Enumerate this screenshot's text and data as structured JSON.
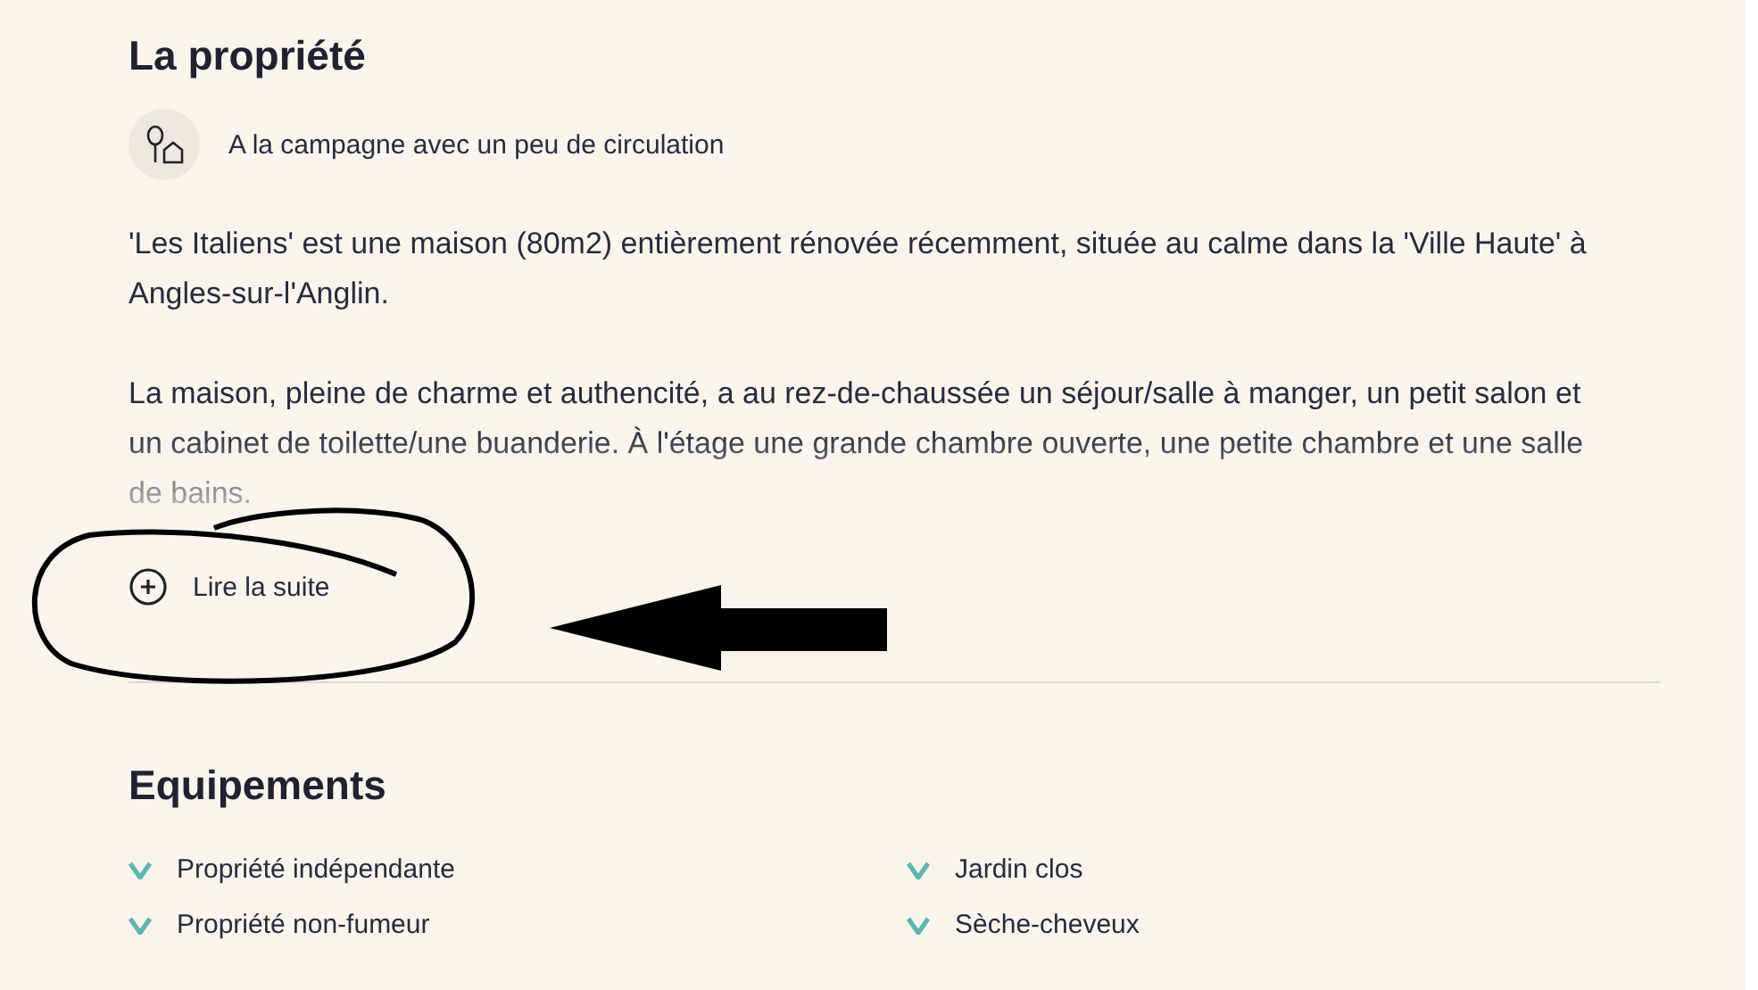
{
  "property": {
    "title": "La propriété",
    "setting": "A la campagne avec un peu de circulation",
    "paragraphs": [
      "'Les Italiens' est une maison (80m2) entièrement rénovée récemment, située au calme dans la 'Ville Haute' à Angles-sur-l'Anglin.",
      "La maison, pleine de charme et authencité, a au rez-de-chaussée un séjour/salle à manger, un petit salon et un cabinet de toilette/une buanderie. À l'étage une grande chambre ouverte, une petite chambre et une salle de bains."
    ],
    "read_more": "Lire la suite"
  },
  "equipment": {
    "title": "Equipements",
    "items": [
      "Propriété indépendante",
      "Jardin clos",
      "Propriété non-fumeur",
      "Sèche-cheveux"
    ]
  },
  "annotations": [
    {
      "kind": "circle"
    },
    {
      "kind": "arrow"
    }
  ]
}
